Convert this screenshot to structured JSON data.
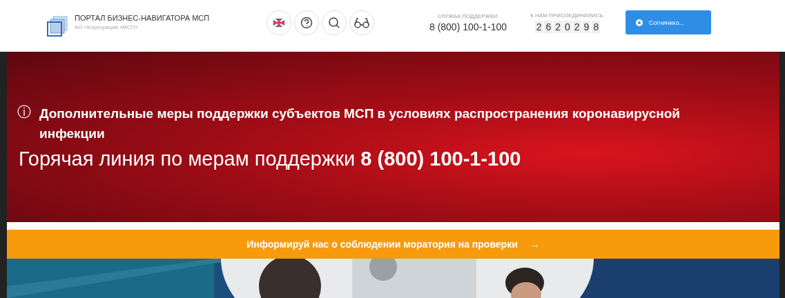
{
  "header": {
    "title": "ПОРТАЛ БИЗНЕС-НАВИГАТОРА МСП",
    "subtitle": "АО «Корпорация «МСП»",
    "tools": [
      {
        "kind": "flag"
      },
      {
        "kind": "help"
      },
      {
        "kind": "search"
      },
      {
        "kind": "glasses"
      }
    ],
    "support": {
      "label": "СЛУЖБА ПОДДЕРЖКИ:",
      "phone": "8 (800) 100-1-100"
    },
    "joined": {
      "label": "К НАМ ПРИСОЕДИНИЛИСЬ:",
      "digits": [
        "2",
        "6",
        "2",
        "0",
        "2",
        "9",
        "8"
      ]
    },
    "button": "Согнинико..."
  },
  "banner": {
    "icon": "ⓘ",
    "headline": "Дополнительные меры поддержки субъектов МСП в условиях распространения коронавирусной инфекции",
    "hotline": "Горячая линия по мерам поддержки **8 (800) 100-1-100**"
  },
  "notice": {
    "text": "Информируй нас о соблюдении моратория на проверки",
    "arrow": "→"
  }
}
